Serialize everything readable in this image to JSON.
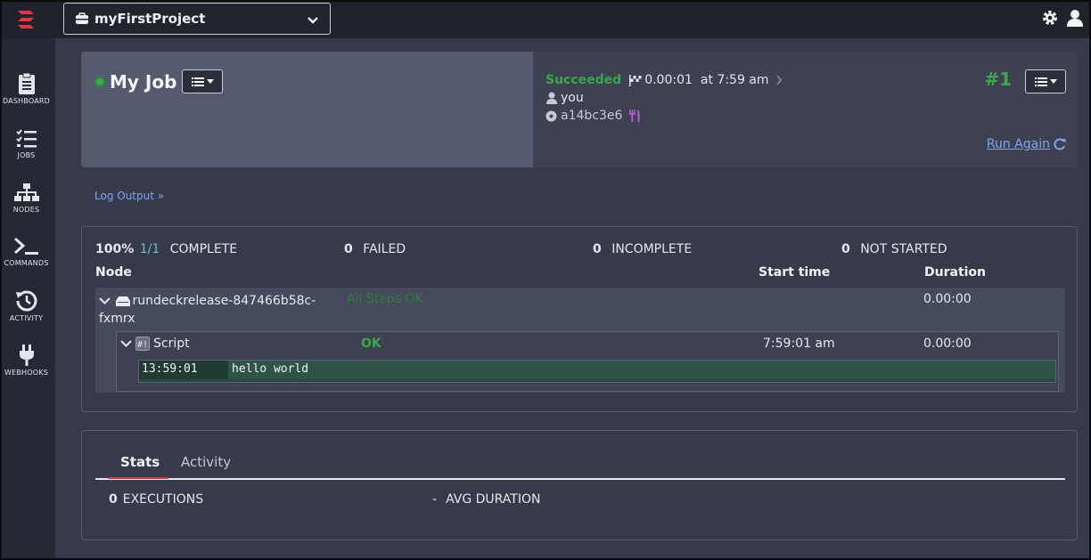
{
  "topbar": {
    "project": "myFirstProject"
  },
  "sidebar": {
    "items": [
      {
        "label": "DASHBOARD",
        "icon": "clipboard-icon"
      },
      {
        "label": "JOBS",
        "icon": "tasks-icon"
      },
      {
        "label": "NODES",
        "icon": "sitemap-icon"
      },
      {
        "label": "COMMANDS",
        "icon": "terminal-icon"
      },
      {
        "label": "ACTIVITY",
        "icon": "history-icon"
      },
      {
        "label": "WEBHOOKS",
        "icon": "plug-icon"
      }
    ]
  },
  "job": {
    "title": "My Job",
    "status": "Succeeded",
    "duration": "0.00:01",
    "time": "at 7:59 am",
    "user": "you",
    "commit": "a14bc3e6",
    "exec_number": "#1",
    "run_again": "Run Again"
  },
  "log_output_link": "Log Output »",
  "summary": {
    "percent": "100%",
    "ratio": "1/1",
    "complete_label": "COMPLETE",
    "failed_count": "0",
    "failed_label": "FAILED",
    "incomplete_count": "0",
    "incomplete_label": "INCOMPLETE",
    "notstarted_count": "0",
    "notstarted_label": "NOT STARTED"
  },
  "table": {
    "col_node": "Node",
    "col_start": "Start time",
    "col_duration": "Duration"
  },
  "node": {
    "name_line1": "rundeckrelease-847466b58c-",
    "name_line2": "fxmrx",
    "status": "All Steps OK",
    "duration": "0.00:00",
    "step": {
      "name": "Script",
      "status": "OK",
      "start": "7:59:01 am",
      "duration": "0.00:00",
      "log_time": "13:59:01",
      "log_message": "hello world"
    }
  },
  "stats": {
    "tabs": [
      "Stats",
      "Activity"
    ],
    "executions_count": "0",
    "executions_label": "EXECUTIONS",
    "avg_value": "-",
    "avg_label": "AVG DURATION"
  },
  "colors": {
    "success": "#3aa84a",
    "link": "#7ea7f0",
    "brand_red": "#d9363e"
  }
}
